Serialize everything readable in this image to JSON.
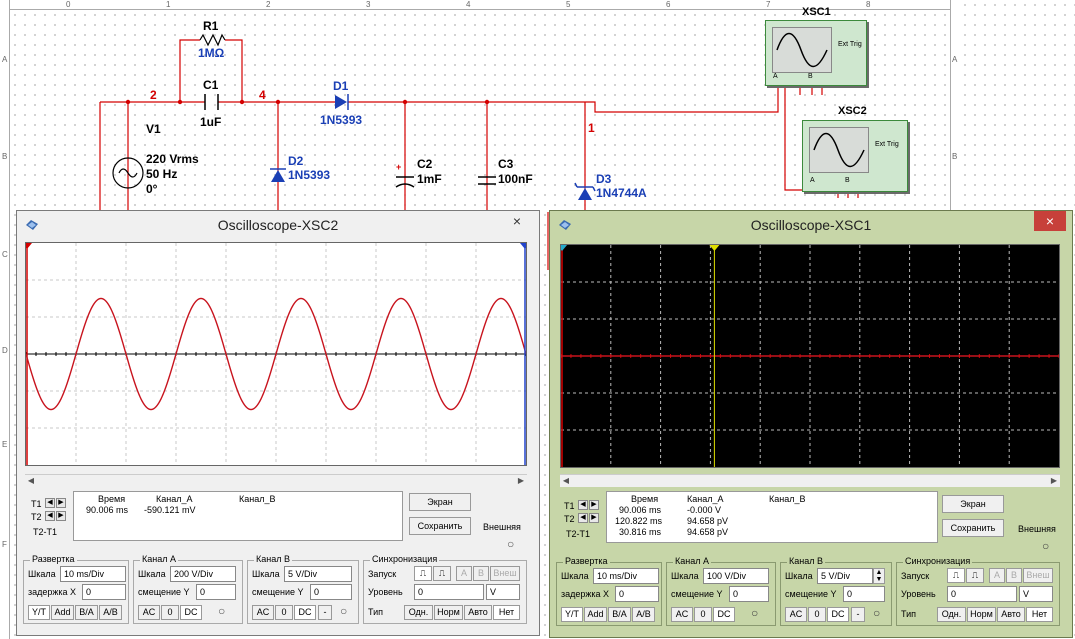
{
  "schematic": {
    "r1": {
      "ref": "R1",
      "value": "1MΩ"
    },
    "c1": {
      "ref": "C1",
      "value": "1uF"
    },
    "d1": {
      "ref": "D1",
      "model": "1N5393"
    },
    "d2": {
      "ref": "D2",
      "model": "1N5393"
    },
    "d3": {
      "ref": "D3",
      "model": "1N4744A"
    },
    "c2": {
      "ref": "C2",
      "value": "1mF",
      "polarity": "+"
    },
    "c3": {
      "ref": "C3",
      "value": "100nF"
    },
    "v1": {
      "ref": "V1",
      "voltage": "220 Vrms",
      "freq": "50 Hz",
      "phase": "0°"
    },
    "nets": {
      "n2": "2",
      "n4": "4",
      "n1": "1"
    },
    "xsc1_label": "XSC1",
    "xsc2_label": "XSC2",
    "ext_trig": "Ext Trig",
    "ch_a": "A",
    "ch_b": "B",
    "ruler_cols": [
      "0",
      "1",
      "2",
      "3",
      "4",
      "5",
      "6",
      "7",
      "8"
    ],
    "ruler_rows": [
      "A",
      "B",
      "C",
      "D",
      "E",
      "F"
    ]
  },
  "osc2": {
    "title": "Oscilloscope-XSC2",
    "close": "×",
    "readout": {
      "t1": "T1",
      "t2": "T2",
      "t2t1": "T2-T1",
      "hdr_time": "Время",
      "hdr_a": "Канал_A",
      "hdr_b": "Канал_B",
      "rows": [
        {
          "time": "90.006 ms",
          "a": "-590.121 mV",
          "b": ""
        }
      ]
    },
    "btn_reverse": "Экран",
    "btn_save": "Сохранить",
    "ext_label": "Внешняя",
    "timebase": {
      "title": "Развертка",
      "scale_label": "Шкала",
      "scale": "10 ms/Div",
      "xpos_label": "задержка X",
      "xpos": "0",
      "modes": [
        "Y/T",
        "Add",
        "B/A",
        "A/B"
      ]
    },
    "cha": {
      "title": "Канал A",
      "scale_label": "Шкала",
      "scale": "200  V/Div",
      "ypos_label": "смещение Y",
      "ypos": "0",
      "coupling": [
        "AC",
        "0",
        "DC"
      ]
    },
    "chb": {
      "title": "Канал B",
      "scale_label": "Шкала",
      "scale": "5  V/Div",
      "ypos_label": "смещение Y",
      "ypos": "0",
      "coupling": [
        "AC",
        "0",
        "DC",
        "-"
      ]
    },
    "trigger": {
      "title": "Синхронизация",
      "edge_label": "Запуск",
      "edge_btns": [
        "A",
        "B",
        "Внеш"
      ],
      "level_label": "Уровень",
      "level": "0",
      "level_unit": "V",
      "type_label": "Тип",
      "type_btns": [
        "Одн.",
        "Норм",
        "Авто",
        "Нет"
      ]
    },
    "signal": {
      "channel": "A",
      "volts_per_div": 200,
      "ms_per_div": 10,
      "amplitude_div": 1.5,
      "period_ms": 20,
      "start_phase_deg": 180,
      "color": "#c8141e"
    }
  },
  "osc1": {
    "title": "Oscilloscope-XSC1",
    "close": "×",
    "readout": {
      "t1": "T1",
      "t2": "T2",
      "t2t1": "T2-T1",
      "hdr_time": "Время",
      "hdr_a": "Канал_A",
      "hdr_b": "Канал_B",
      "rows": [
        {
          "time": "90.006 ms",
          "a": "-0.000 V",
          "b": ""
        },
        {
          "time": "120.822 ms",
          "a": "94.658 pV",
          "b": ""
        },
        {
          "time": "30.816 ms",
          "a": "94.658 pV",
          "b": ""
        }
      ]
    },
    "btn_reverse": "Экран",
    "btn_save": "Сохранить",
    "ext_label": "Внешняя",
    "timebase": {
      "title": "Развертка",
      "scale_label": "Шкала",
      "scale": "10 ms/Div",
      "xpos_label": "задержка X",
      "xpos": "0",
      "modes": [
        "Y/T",
        "Add",
        "B/A",
        "A/B"
      ]
    },
    "cha": {
      "title": "Канал A",
      "scale_label": "Шкала",
      "scale": "100  V/Div",
      "ypos_label": "смещение Y",
      "ypos": "0",
      "coupling": [
        "AC",
        "0",
        "DC"
      ]
    },
    "chb": {
      "title": "Канал B",
      "scale_label": "Шкала",
      "scale": "5  V/Div",
      "ypos_label": "смещение Y",
      "ypos": "0",
      "coupling": [
        "AC",
        "0",
        "DC",
        "-"
      ]
    },
    "trigger": {
      "title": "Синхронизация",
      "edge_label": "Запуск",
      "edge_btns": [
        "A",
        "B",
        "Внеш"
      ],
      "level_label": "Уровень",
      "level": "0",
      "level_unit": "V",
      "type_label": "Тип",
      "type_btns": [
        "Одн.",
        "Норм",
        "Авто",
        "Нет"
      ]
    },
    "signal": {
      "channel": "A",
      "level_v": 0,
      "color": "#c8141e"
    }
  },
  "colors": {
    "wire": "#d40000",
    "display_white": "#ffffff",
    "display_black": "#000000",
    "osc1_chrome": "#c7d6a8",
    "osc2_chrome": "#f0f0f0",
    "component_blue": "#1a3fb5"
  }
}
